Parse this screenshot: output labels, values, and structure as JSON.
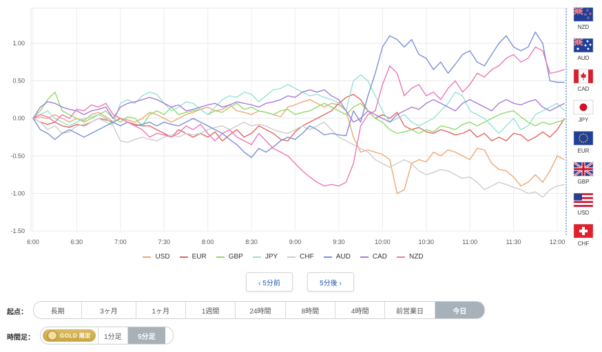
{
  "chart_data": {
    "type": "line",
    "xlim": [
      "6:00",
      "12:05"
    ],
    "ylim": [
      -1.5,
      1.5
    ],
    "x_ticks": [
      "6:00",
      "6:30",
      "7:00",
      "7:30",
      "8:00",
      "8:30",
      "9:00",
      "9:30",
      "10:00",
      "10:30",
      "11:00",
      "11:30",
      "12:00"
    ],
    "y_ticks": [
      1.0,
      0.5,
      0.0,
      -0.5,
      -1.0,
      -1.5
    ],
    "y_tick_labels": [
      "1.00",
      "0.50",
      "0.00",
      "-0.50",
      "-1.00",
      "-1.50"
    ],
    "grid": true,
    "legend_position": "bottom",
    "series": [
      {
        "name": "USD",
        "color": "#f0a672",
        "values": [
          0,
          0.02,
          0,
          0.05,
          0,
          -0.05,
          0,
          -0.03,
          0.05,
          0.08,
          0.02,
          -0.05,
          0,
          -0.02,
          -0.05,
          0,
          0.08,
          0.05,
          0,
          -0.05,
          0,
          0.05,
          0.08,
          0.12,
          0.15,
          0.1,
          0.12,
          0.18,
          0.1,
          0.08,
          0.05,
          0.1,
          0.08,
          0.05,
          0.02,
          0.15,
          0.18,
          0.22,
          0.25,
          0.2,
          0.15,
          0.2,
          0.18,
          0.1,
          -0.25,
          -0.45,
          -0.42,
          -0.45,
          -0.48,
          -0.55,
          -1.0,
          -0.95,
          -0.6,
          -0.55,
          -0.58,
          -0.45,
          -0.5,
          -0.42,
          -0.45,
          -0.5,
          -0.55,
          -0.4,
          -0.42,
          -0.6,
          -0.68,
          -0.7,
          -0.78,
          -0.9,
          -0.85,
          -0.75,
          -0.85,
          -0.7,
          -0.5,
          -0.55
        ]
      },
      {
        "name": "EUR",
        "color": "#e06560",
        "values": [
          0,
          -0.05,
          -0.08,
          -0.05,
          -0.1,
          -0.12,
          -0.08,
          -0.1,
          -0.05,
          0,
          -0.02,
          -0.05,
          0,
          -0.05,
          -0.08,
          -0.1,
          -0.1,
          -0.15,
          -0.2,
          -0.25,
          -0.15,
          -0.2,
          -0.25,
          -0.2,
          -0.25,
          -0.18,
          -0.3,
          -0.22,
          -0.15,
          -0.25,
          -0.2,
          -0.1,
          -0.15,
          -0.2,
          -0.28,
          -0.3,
          -0.18,
          -0.1,
          -0.05,
          0,
          0.05,
          0.1,
          0.2,
          0.28,
          0.32,
          0.25,
          0.1,
          0,
          0.05,
          0,
          0.08,
          -0.1,
          -0.15,
          -0.12,
          -0.18,
          -0.2,
          -0.15,
          -0.18,
          -0.22,
          -0.2,
          -0.15,
          -0.25,
          -0.2,
          -0.3,
          -0.25,
          -0.3,
          -0.2,
          -0.22,
          -0.3,
          -0.25,
          -0.18,
          -0.25,
          -0.15,
          0.0
        ]
      },
      {
        "name": "GBP",
        "color": "#8fd96e",
        "values": [
          0,
          0.1,
          0.25,
          0.35,
          0.1,
          0.05,
          0,
          -0.05,
          0,
          0.05,
          0.1,
          0,
          -0.05,
          0.02,
          0,
          -0.1,
          0.05,
          0.1,
          0.05,
          0.15,
          0.05,
          0.08,
          0.1,
          0.12,
          0.05,
          0.1,
          0.08,
          0.15,
          0.2,
          0.12,
          0.15,
          0.1,
          0.08,
          0.05,
          0.1,
          0.12,
          0.05,
          0.08,
          0.1,
          0.15,
          0.2,
          0.15,
          0.1,
          0.05,
          0.15,
          0.2,
          0.1,
          0,
          -0.05,
          -0.15,
          -0.2,
          -0.18,
          -0.15,
          -0.2,
          -0.15,
          -0.18,
          -0.1,
          -0.12,
          -0.15,
          -0.08,
          -0.05,
          -0.1,
          -0.05,
          0,
          0.05,
          0.08,
          0.1,
          0.02,
          -0.05,
          -0.1,
          -0.05,
          -0.08,
          -0.05,
          -0.02
        ]
      },
      {
        "name": "JPY",
        "color": "#93e3d3",
        "values": [
          0,
          0.05,
          0.1,
          0,
          -0.05,
          -0.1,
          -0.05,
          0,
          0.02,
          0.05,
          0,
          -0.08,
          0.2,
          0.25,
          0.2,
          0.3,
          0.35,
          0.32,
          0.2,
          0.1,
          0.15,
          0.22,
          0.2,
          0.12,
          0.05,
          0.15,
          0.25,
          0.3,
          0.28,
          0.35,
          0.32,
          0.22,
          0.3,
          0.38,
          0.4,
          0.45,
          0.4,
          0.35,
          0.3,
          0.32,
          0.28,
          0.25,
          0.2,
          0.1,
          0.5,
          0.58,
          0.5,
          0.3,
          0.1,
          -0.05,
          0,
          0.05,
          -0.05,
          -0.1,
          -0.05,
          0,
          0.1,
          0.2,
          0.35,
          0.3,
          0.1,
          0.05,
          0,
          -0.1,
          -0.2,
          -0.1,
          0,
          -0.15,
          -0.1,
          0.05,
          0.1,
          0.15,
          0.2,
          0.1
        ]
      },
      {
        "name": "CHF",
        "color": "#cccccc",
        "values": [
          0,
          -0.05,
          -0.15,
          -0.1,
          -0.2,
          -0.18,
          -0.1,
          -0.08,
          -0.05,
          0,
          -0.05,
          -0.1,
          -0.3,
          -0.32,
          -0.28,
          -0.25,
          -0.28,
          -0.3,
          -0.25,
          -0.22,
          -0.25,
          -0.2,
          -0.22,
          -0.2,
          -0.15,
          -0.12,
          -0.1,
          -0.15,
          -0.1,
          -0.05,
          -0.1,
          -0.08,
          -0.1,
          -0.15,
          -0.18,
          -0.2,
          -0.15,
          -0.1,
          -0.15,
          -0.1,
          -0.05,
          -0.15,
          -0.25,
          -0.3,
          -0.35,
          -0.4,
          -0.45,
          -0.55,
          -0.6,
          -0.65,
          -0.6,
          -0.55,
          -0.6,
          -0.7,
          -0.75,
          -0.72,
          -0.68,
          -0.7,
          -0.75,
          -0.8,
          -0.78,
          -0.85,
          -0.95,
          -0.9,
          -0.85,
          -0.88,
          -0.92,
          -0.95,
          -1.0,
          -0.98,
          -1.05,
          -0.95,
          -0.9,
          -0.88
        ]
      },
      {
        "name": "AUD",
        "color": "#7b8fd6",
        "values": [
          0,
          -0.15,
          -0.2,
          -0.28,
          -0.2,
          -0.15,
          -0.2,
          -0.25,
          -0.2,
          -0.15,
          -0.1,
          -0.05,
          -0.1,
          -0.05,
          -0.1,
          -0.08,
          -0.05,
          -0.1,
          -0.05,
          -0.08,
          -0.1,
          -0.05,
          0,
          -0.05,
          -0.1,
          -0.15,
          -0.2,
          -0.28,
          -0.35,
          -0.45,
          -0.52,
          -0.4,
          -0.45,
          -0.38,
          -0.3,
          -0.25,
          -0.28,
          -0.2,
          -0.1,
          -0.15,
          -0.22,
          -0.2,
          -0.22,
          -0.23,
          0.1,
          -0.05,
          0.3,
          0.6,
          0.95,
          1.1,
          1.05,
          0.95,
          1.05,
          0.85,
          0.8,
          0.65,
          0.75,
          0.6,
          0.72,
          0.85,
          0.9,
          0.75,
          0.7,
          0.85,
          1.0,
          1.1,
          0.95,
          0.9,
          0.95,
          1.15,
          1.0,
          0.5,
          0.48,
          0.48
        ]
      },
      {
        "name": "CAD",
        "color": "#a67ad9",
        "values": [
          0,
          0.15,
          0.22,
          0.2,
          0.15,
          0.12,
          0.1,
          0.05,
          0.1,
          0.12,
          0.15,
          0,
          0.15,
          0.2,
          0.22,
          0.25,
          0.28,
          0.25,
          0.2,
          0.15,
          0.18,
          0.1,
          0.12,
          0.15,
          0.18,
          0.2,
          0.15,
          0.18,
          0.22,
          0.2,
          0.18,
          0.15,
          0.2,
          0.22,
          0.25,
          0.3,
          0.28,
          0.35,
          0.38,
          0.35,
          0.38,
          0.3,
          0.25,
          0.1,
          -0.05,
          0,
          0.1,
          0.05,
          0,
          -0.05,
          0.05,
          0.1,
          0.15,
          0.12,
          0.2,
          0.25,
          0.2,
          0.15,
          0.1,
          0.2,
          0.25,
          0.2,
          0.15,
          0.1,
          0.2,
          0.25,
          0.2,
          0.18,
          0.22,
          0.25,
          0.15,
          0.1,
          0.15,
          0.2
        ]
      },
      {
        "name": "NZD",
        "color": "#ec76b5",
        "values": [
          0,
          0.05,
          0.02,
          -0.05,
          0.05,
          0,
          0.12,
          0.1,
          0.18,
          0.15,
          0.2,
          0.05,
          0,
          -0.05,
          -0.1,
          -0.15,
          -0.25,
          -0.2,
          -0.22,
          -0.25,
          -0.2,
          -0.1,
          -0.15,
          -0.08,
          -0.2,
          -0.3,
          -0.2,
          -0.15,
          -0.25,
          -0.3,
          -0.35,
          -0.2,
          -0.3,
          -0.4,
          -0.45,
          -0.5,
          -0.6,
          -0.7,
          -0.78,
          -0.85,
          -0.9,
          -0.88,
          -0.9,
          -0.85,
          -0.6,
          -0.1,
          0.05,
          0.1,
          0.45,
          0.7,
          0.6,
          0.3,
          0.4,
          0.45,
          0.3,
          0.35,
          0.25,
          0.4,
          0.5,
          0.35,
          0.45,
          0.6,
          0.55,
          0.65,
          0.7,
          0.8,
          0.85,
          0.75,
          0.8,
          0.95,
          0.9,
          0.6,
          0.62,
          0.65
        ]
      }
    ]
  },
  "flags": [
    {
      "code": "NZD",
      "label": "NZD"
    },
    {
      "code": "AUD",
      "label": "AUD"
    },
    {
      "code": "CAD",
      "label": "CAD"
    },
    {
      "code": "JPY",
      "label": "JPY"
    },
    {
      "code": "EUR",
      "label": "EUR"
    },
    {
      "code": "GBP",
      "label": "GBP"
    },
    {
      "code": "USD",
      "label": "USD"
    },
    {
      "code": "CHF",
      "label": "CHF"
    }
  ],
  "nav": {
    "prev_label": "‹ 5分前",
    "next_label": "5分後 ›"
  },
  "origin": {
    "label": "起点：",
    "options": [
      "長期",
      "3ヶ月",
      "1ヶ月",
      "1週間",
      "24時間",
      "8時間",
      "4時間",
      "前営業日",
      "今日"
    ],
    "selected": "今日"
  },
  "timeframe": {
    "label": "時間足：",
    "gold_label": "GOLD 限定",
    "options": [
      "1分足",
      "5分足"
    ],
    "selected": "5分足"
  }
}
